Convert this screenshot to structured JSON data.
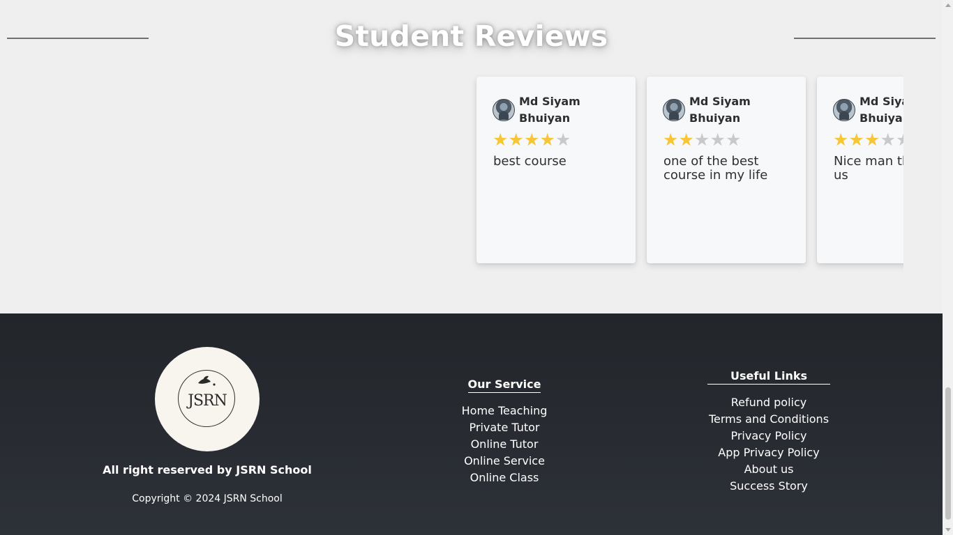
{
  "reviews_section": {
    "title": "Student Reviews",
    "cards": [
      {
        "name": "Md Siyam Bhuiyan",
        "rating": 4,
        "max_rating": 5,
        "text": "best course"
      },
      {
        "name": "Md Siyam Bhuiyan",
        "rating": 2,
        "max_rating": 5,
        "text": "one of the best course in my life"
      },
      {
        "name": "Md Siyam Bhuiyan",
        "rating": 3,
        "max_rating": 5,
        "text": "Nice man that help us"
      }
    ],
    "star_filled_color": "#f7c638",
    "star_empty_color": "#c9c9c9"
  },
  "footer": {
    "logo_text": "JSRN",
    "rights": "All right reserved by JSRN School",
    "copyright": "Copyright © 2024 JSRN School",
    "service": {
      "title": "Our Service",
      "items": [
        "Home Teaching",
        "Private Tutor",
        "Online Tutor",
        "Online Service",
        "Online Class"
      ]
    },
    "useful_links": {
      "title": "Useful Links",
      "items": [
        "Refund policy",
        "Terms and Conditions",
        "Privacy Policy",
        "App Privacy Policy",
        "About us",
        "Success Story"
      ]
    },
    "background_color": "#22262b"
  }
}
